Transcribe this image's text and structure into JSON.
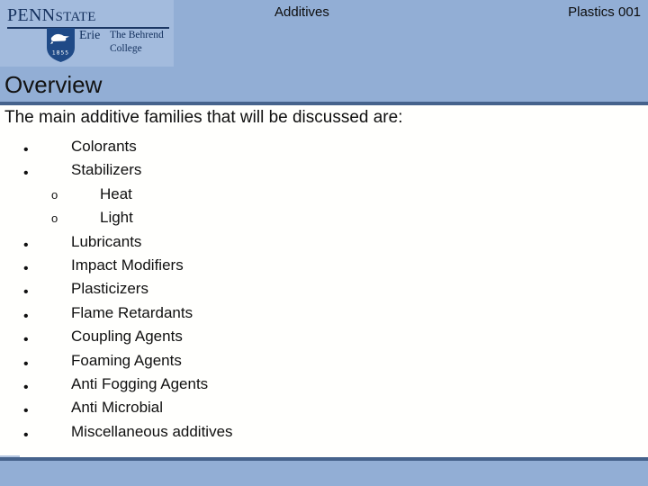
{
  "header": {
    "subject": "Additives",
    "course": "Plastics 001",
    "logo": {
      "wordmark_penn": "PENN",
      "wordmark_state": "STATE",
      "campus": "Erie",
      "college_line1": "The Behrend",
      "college_line2": "College",
      "shield_year": "1855",
      "shield_icon": "penn-state-lion-shield-icon"
    },
    "band_color": "#92aed5",
    "rule_color": "#46638c"
  },
  "slide": {
    "title": "Overview",
    "lead": "The main additive families that will be discussed are:",
    "bullets": [
      {
        "level": 1,
        "marker": "•",
        "label": "Colorants"
      },
      {
        "level": 1,
        "marker": "•",
        "label": "Stabilizers"
      },
      {
        "level": 2,
        "marker": "o",
        "label": "Heat"
      },
      {
        "level": 2,
        "marker": "o",
        "label": "Light"
      },
      {
        "level": 1,
        "marker": "•",
        "label": "Lubricants"
      },
      {
        "level": 1,
        "marker": "•",
        "label": "Impact Modifiers"
      },
      {
        "level": 1,
        "marker": "•",
        "label": "Plasticizers"
      },
      {
        "level": 1,
        "marker": "•",
        "label": "Flame Retardants"
      },
      {
        "level": 1,
        "marker": "•",
        "label": "Coupling Agents"
      },
      {
        "level": 1,
        "marker": "•",
        "label": "Foaming Agents"
      },
      {
        "level": 1,
        "marker": "•",
        "label": "Anti Fogging Agents"
      },
      {
        "level": 1,
        "marker": "•",
        "label": "Anti Microbial"
      },
      {
        "level": 1,
        "marker": "•",
        "label": "Miscellaneous additives"
      }
    ]
  },
  "footer": {
    "band_color": "#92aed5",
    "rule_color": "#46638c"
  }
}
